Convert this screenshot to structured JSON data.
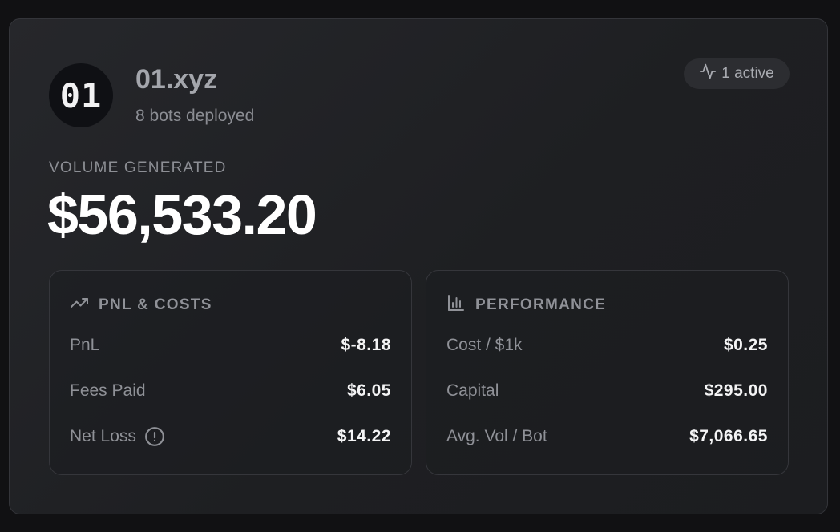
{
  "header": {
    "avatar_text": "01",
    "title": "01.xyz",
    "subtitle": "8 bots deployed",
    "badge": "1 active"
  },
  "volume": {
    "label": "VOLUME GENERATED",
    "value": "$56,533.20"
  },
  "pnl_panel": {
    "title": "PNL & COSTS",
    "icon": "trending-up-icon",
    "rows": [
      {
        "label": "PnL",
        "value": "$-8.18"
      },
      {
        "label": "Fees Paid",
        "value": "$6.05"
      },
      {
        "label": "Net Loss",
        "value": "$14.22",
        "icon": "info-icon"
      }
    ]
  },
  "perf_panel": {
    "title": "PERFORMANCE",
    "icon": "bar-chart-icon",
    "rows": [
      {
        "label": "Cost / $1k",
        "value": "$0.25"
      },
      {
        "label": "Capital",
        "value": "$295.00"
      },
      {
        "label": "Avg. Vol / Bot",
        "value": "$7,066.65"
      }
    ]
  },
  "colors": {
    "background": "#111113",
    "card": "#232428",
    "text_primary": "#ffffff",
    "text_muted": "#8f9197"
  }
}
